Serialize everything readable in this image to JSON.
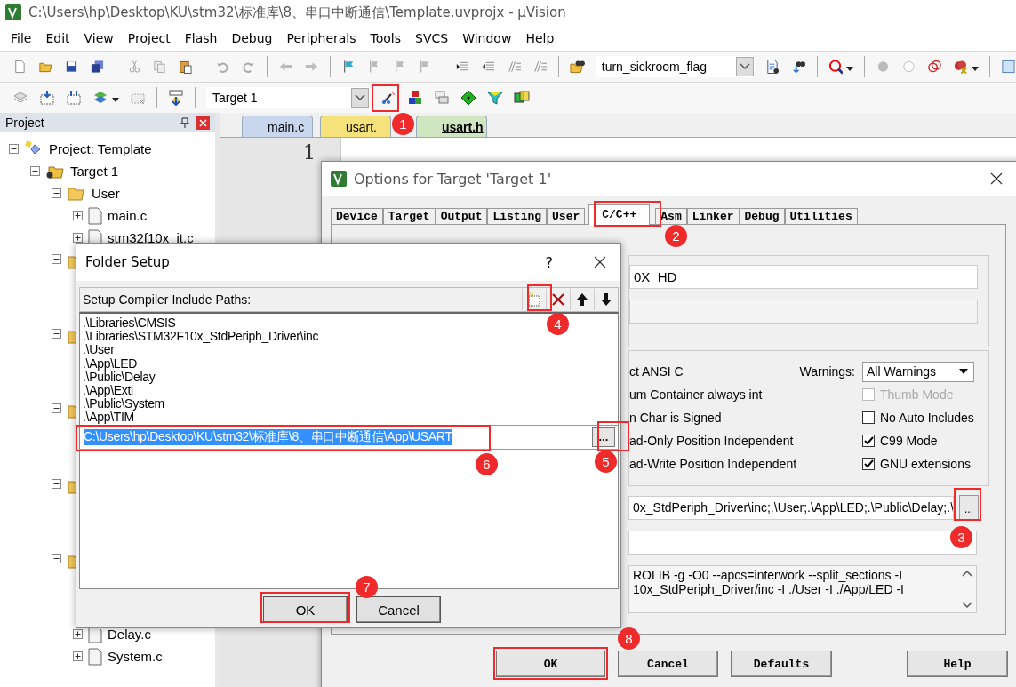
{
  "window": {
    "title": "C:\\Users\\hp\\Desktop\\KU\\stm32\\标准库\\8、串口中断通信\\Template.uvprojx - µVision"
  },
  "menu": [
    "File",
    "Edit",
    "View",
    "Project",
    "Flash",
    "Debug",
    "Peripherals",
    "Tools",
    "SVCS",
    "Window",
    "Help"
  ],
  "toolbar_1": {
    "find_combo": "turn_sickroom_flag"
  },
  "toolbar_2": {
    "target_combo": "Target 1"
  },
  "project_panel": {
    "title": "Project",
    "tree": [
      {
        "kind": "project",
        "label": "Project: Template",
        "expanded": true,
        "children": [
          {
            "kind": "target",
            "label": "Target 1",
            "expanded": true,
            "children": [
              {
                "kind": "folder",
                "label": "User",
                "expanded": true,
                "children": [
                  {
                    "kind": "file",
                    "label": "main.c",
                    "expanded": false
                  },
                  {
                    "kind": "file",
                    "label": "stm32f10x_it.c",
                    "expanded": false
                  }
                ]
              },
              {
                "kind": "folder",
                "expanded": true
              },
              {
                "kind": "folder",
                "expanded": true
              },
              {
                "kind": "folder",
                "expanded": true
              },
              {
                "kind": "folder",
                "expanded": true
              },
              {
                "kind": "folder",
                "expanded": true,
                "children": [
                  {
                    "kind": "file",
                    "label": "Delay.c",
                    "expanded": false
                  },
                  {
                    "kind": "file",
                    "label": "System.c",
                    "expanded": false
                  }
                ]
              }
            ]
          }
        ]
      }
    ]
  },
  "editor": {
    "tabs": [
      {
        "label": "main.c",
        "selected": false,
        "color": "#c9d7ee"
      },
      {
        "label": "usart.",
        "selected": false,
        "color": "#f6e27a"
      },
      {
        "label": "usart.h",
        "selected": true,
        "color": "#cfe6c0"
      }
    ],
    "line_number": "1"
  },
  "options_dialog": {
    "title": "Options for Target 'Target 1'",
    "tabs": [
      {
        "label": "Device",
        "selected": false
      },
      {
        "label": "Target",
        "selected": false
      },
      {
        "label": "Output",
        "selected": false
      },
      {
        "label": "Listing",
        "selected": false
      },
      {
        "label": "User",
        "selected": false
      },
      {
        "label": "C/C++",
        "selected": true
      },
      {
        "label": "Asm",
        "selected": false
      },
      {
        "label": "Linker",
        "selected": false
      },
      {
        "label": "Debug",
        "selected": false
      },
      {
        "label": "Utilities",
        "selected": false
      }
    ],
    "define": "0X_HD",
    "language_options": [
      "ct ANSI C",
      "um Container always int",
      "n Char is Signed",
      "ad-Only Position Independent",
      "ad-Write Position Independent"
    ],
    "warnings_label": "Warnings:",
    "warnings_value": "All Warnings",
    "checkboxes": [
      {
        "label": "Thumb Mode",
        "checked": false,
        "disabled": true
      },
      {
        "label": "No Auto Includes",
        "checked": false,
        "disabled": false
      },
      {
        "label": "C99 Mode",
        "checked": true,
        "disabled": false
      },
      {
        "label": "GNU extensions",
        "checked": true,
        "disabled": false
      }
    ],
    "include_paths": "0x_StdPeriph_Driver\\inc;.\\User;.\\App\\LED;.\\Public\\Delay;.\\",
    "browse_button": "...",
    "compiler_control": [
      "ROLIB -g -O0 --apcs=interwork --split_sections -I",
      "10x_StdPeriph_Driver/inc -I ./User -I ./App/LED -I"
    ],
    "buttons": [
      "OK",
      "Cancel",
      "Defaults",
      "Help"
    ]
  },
  "folder_setup": {
    "title": "Folder Setup",
    "help": "?",
    "heading": "Setup Compiler Include Paths:",
    "paths": [
      ".\\Libraries\\CMSIS",
      ".\\Libraries\\STM32F10x_StdPeriph_Driver\\inc",
      ".\\User",
      ".\\App\\LED",
      ".\\Public\\Delay",
      ".\\App\\Exti",
      ".\\Public\\System",
      ".\\App\\TIM"
    ],
    "editing_path": "C:\\Users\\hp\\Desktop\\KU\\stm32\\标准库\\8、串口中断通信\\App\\USART",
    "text_selected": true,
    "browse_button": "...",
    "buttons": [
      "OK",
      "Cancel"
    ]
  },
  "annotations": [
    {
      "number": "1"
    },
    {
      "number": "2"
    },
    {
      "number": "3"
    },
    {
      "number": "4"
    },
    {
      "number": "5"
    },
    {
      "number": "6"
    },
    {
      "number": "7"
    },
    {
      "number": "8"
    }
  ]
}
